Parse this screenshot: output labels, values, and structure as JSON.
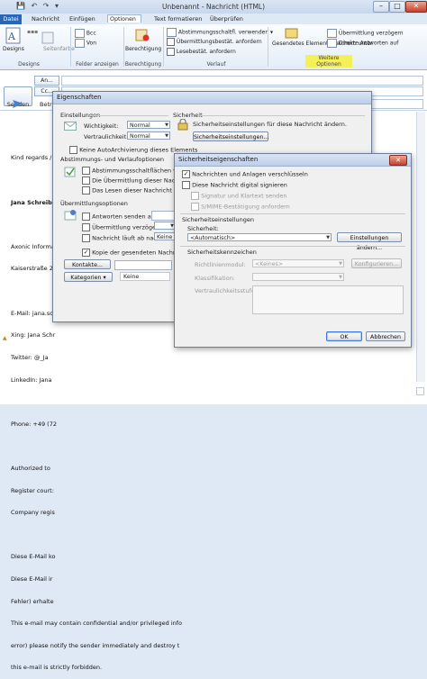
{
  "window": {
    "title": "Unbenannt - Nachricht (HTML)",
    "min": "–",
    "max": "□",
    "close": "✕"
  },
  "tabs": [
    "Datei",
    "Nachricht",
    "Einfügen",
    "Optionen",
    "Text formatieren",
    "Überprüfen"
  ],
  "ribbon": {
    "designs": "Designs",
    "designs_group": "Designs",
    "page_color": "Seitenfarbe",
    "bcc": "Bcc",
    "from": "Von",
    "fields_group": "Felder anzeigen",
    "permission": "Berechtigung",
    "permission_group": "Berechtigung",
    "voting": "Abstimmungsschaltfl. verwenden",
    "delivery_receipt": "Übermittlungsbestät. anfordern",
    "read_receipt": "Lesebestät. anfordern",
    "tracking_group": "Verlauf",
    "save_sent": "Gesendetes Element speichern unter",
    "delay": "Übermittlung verzögern",
    "direct_replies": "Direkte Antworten auf",
    "more_options_group": "Weitere Optionen"
  },
  "compose": {
    "send": "Senden",
    "to": "An...",
    "cc": "Cc...",
    "subject_label": "Betreff:",
    "body_lines": [
      "Kind regards /",
      "",
      "Jana Schreib",
      "",
      "Axonic Informat",
      "Kaiserstraße 24",
      "",
      "E-Mail: jana.sch",
      "Xing: Jana Schr",
      "Twitter: @_Ja",
      "LinkedIn: Jana",
      "",
      "Phone: +49 (72",
      "",
      "Authorized to",
      "Register court:",
      "Company regis",
      "",
      "Diese E-Mail ko",
      "Diese E-Mail ir",
      "Fehler) erhalte"
    ],
    "body_bottom": [
      "This e-mail may contain confidential and/or privileged info",
      "error) please notify the sender immediately and destroy t",
      "this e-mail is strictly forbidden."
    ]
  },
  "props": {
    "title": "Eigenschaften",
    "settings": "Einstellungen",
    "importance": "Wichtigkeit:",
    "importance_val": "Normal",
    "sensitivity": "Vertraulichkeit:",
    "sensitivity_val": "Normal",
    "security": "Sicherheit",
    "security_text": "Sicherheitseinstellungen für diese Nachricht ändern.",
    "security_btn": "Sicherheitseinstellungen...",
    "no_archive": "Keine AutoArchivierung dieses Elements",
    "voting_group": "Abstimmungs- und Verlaufoptionen",
    "voting_buttons": "Abstimmungsschaltflächen verwen",
    "delivery": "Die Übermittlung dieser Nachricht be",
    "read": "Das Lesen dieser Nachricht bestätige",
    "delivery_group": "Übermittlungsoptionen",
    "replies_to": "Antworten senden an:",
    "no_delivery_before": "Übermittlung verzögern bis:",
    "expires": "Nachricht läuft ab nach:",
    "none_val": "Keine",
    "save_copy": "Kopie der gesendeten Nachricht spei",
    "contacts_btn": "Kontakte...",
    "categories_btn": "Kategorien",
    "categories_val": "Keine"
  },
  "sec": {
    "title": "Sicherheitseigenschaften",
    "encrypt": "Nachrichten und Anlagen verschlüsseln",
    "sign": "Diese Nachricht digital signieren",
    "cleartext": "Signatur und Klartext senden",
    "smime": "S/MIME-Bestätigung anfordern",
    "settings_group": "Sicherheitseinstellungen",
    "setting_label": "Sicherheit:",
    "setting_val": "<Automatisch>",
    "change_btn": "Einstellungen ändern...",
    "label_group": "Sicherheitskennzeichen",
    "policy_label": "Richtlinienmodul:",
    "policy_val": "<Keines>",
    "configure_btn": "Konfigurieren...",
    "class_label": "Klassifikation:",
    "mark_label": "Vertraulichkeitsstufe:",
    "ok": "OK",
    "cancel": "Abbrechen"
  }
}
